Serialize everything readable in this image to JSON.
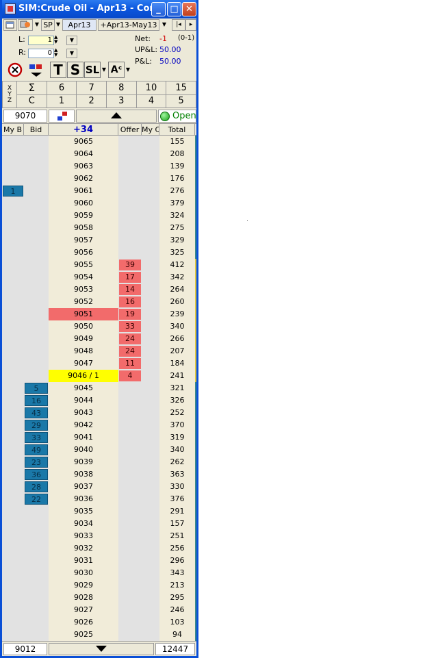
{
  "window": {
    "title": "SIM:Crude Oil - Apr13 - Con...",
    "minimize_label": "_",
    "maximize_label": "□",
    "close_label": "✕"
  },
  "toolbar": {
    "exchange": "SP",
    "contract": "Apr13",
    "spread": "+Apr13-May13",
    "nav_first": "|◂",
    "nav_next": "▸"
  },
  "order_entry": {
    "l_label": "L:",
    "l_value": "1",
    "r_label": "R:",
    "r_value": "0"
  },
  "position": {
    "net_label": "Net:",
    "net_value": "-1",
    "net_detail": "(0-1)",
    "upl_label": "UP&L:",
    "upl_value": "50.00",
    "pl_label": "P&L:",
    "pl_value": "50.00"
  },
  "tool_buttons": {
    "t_label": "T",
    "s_label": "S",
    "sl_label": "SL",
    "alpha_label": "Aᶜ"
  },
  "quantity_grid": {
    "row1_label": "X",
    "row2_label": "Y",
    "row3_label": "Z",
    "row1": [
      "Σ",
      "6",
      "7",
      "8",
      "10",
      "15"
    ],
    "row2": [
      "C",
      "1",
      "2",
      "3",
      "4",
      "5"
    ]
  },
  "status": {
    "price": "9070",
    "market_state": "Open"
  },
  "columns": {
    "my_bid": "My B",
    "bid": "Bid",
    "net_change": "+34",
    "offer": "Offer",
    "my_offer": "My C",
    "total": "Total"
  },
  "ladder": [
    {
      "price": "9065",
      "total": "155",
      "my_bid": "",
      "bid": "",
      "offer": ""
    },
    {
      "price": "9064",
      "total": "208",
      "my_bid": "",
      "bid": "",
      "offer": ""
    },
    {
      "price": "9063",
      "total": "139",
      "my_bid": "",
      "bid": "",
      "offer": ""
    },
    {
      "price": "9062",
      "total": "176",
      "my_bid": "",
      "bid": "",
      "offer": ""
    },
    {
      "price": "9061",
      "total": "276",
      "my_bid": "1",
      "bid": "",
      "offer": ""
    },
    {
      "price": "9060",
      "total": "379",
      "my_bid": "",
      "bid": "",
      "offer": ""
    },
    {
      "price": "9059",
      "total": "324",
      "my_bid": "",
      "bid": "",
      "offer": ""
    },
    {
      "price": "9058",
      "total": "275",
      "my_bid": "",
      "bid": "",
      "offer": ""
    },
    {
      "price": "9057",
      "total": "329",
      "my_bid": "",
      "bid": "",
      "offer": ""
    },
    {
      "price": "9056",
      "total": "325",
      "my_bid": "",
      "bid": "",
      "offer": ""
    },
    {
      "price": "9055",
      "total": "412",
      "my_bid": "",
      "bid": "",
      "offer": "39"
    },
    {
      "price": "9054",
      "total": "342",
      "my_bid": "",
      "bid": "",
      "offer": "17"
    },
    {
      "price": "9053",
      "total": "264",
      "my_bid": "",
      "bid": "",
      "offer": "14"
    },
    {
      "price": "9052",
      "total": "260",
      "my_bid": "",
      "bid": "",
      "offer": "16"
    },
    {
      "price": "9051",
      "total": "239",
      "my_bid": "",
      "bid": "",
      "offer": "19",
      "last": true
    },
    {
      "price": "9050",
      "total": "340",
      "my_bid": "",
      "bid": "",
      "offer": "33"
    },
    {
      "price": "9049",
      "total": "266",
      "my_bid": "",
      "bid": "",
      "offer": "24"
    },
    {
      "price": "9048",
      "total": "207",
      "my_bid": "",
      "bid": "",
      "offer": "24"
    },
    {
      "price": "9047",
      "total": "184",
      "my_bid": "",
      "bid": "",
      "offer": "11"
    },
    {
      "price": "9046 / 1",
      "total": "241",
      "my_bid": "",
      "bid": "",
      "offer": "4",
      "inside": true
    },
    {
      "price": "9045",
      "total": "321",
      "my_bid": "",
      "bid": "5",
      "offer": ""
    },
    {
      "price": "9044",
      "total": "326",
      "my_bid": "",
      "bid": "16",
      "offer": ""
    },
    {
      "price": "9043",
      "total": "252",
      "my_bid": "",
      "bid": "43",
      "offer": ""
    },
    {
      "price": "9042",
      "total": "370",
      "my_bid": "",
      "bid": "29",
      "offer": ""
    },
    {
      "price": "9041",
      "total": "319",
      "my_bid": "",
      "bid": "33",
      "offer": ""
    },
    {
      "price": "9040",
      "total": "340",
      "my_bid": "",
      "bid": "49",
      "offer": ""
    },
    {
      "price": "9039",
      "total": "262",
      "my_bid": "",
      "bid": "23",
      "offer": ""
    },
    {
      "price": "9038",
      "total": "363",
      "my_bid": "",
      "bid": "36",
      "offer": ""
    },
    {
      "price": "9037",
      "total": "330",
      "my_bid": "",
      "bid": "28",
      "offer": ""
    },
    {
      "price": "9036",
      "total": "376",
      "my_bid": "",
      "bid": "22",
      "offer": ""
    },
    {
      "price": "9035",
      "total": "291",
      "my_bid": "",
      "bid": "",
      "offer": ""
    },
    {
      "price": "9034",
      "total": "157",
      "my_bid": "",
      "bid": "",
      "offer": ""
    },
    {
      "price": "9033",
      "total": "251",
      "my_bid": "",
      "bid": "",
      "offer": ""
    },
    {
      "price": "9032",
      "total": "256",
      "my_bid": "",
      "bid": "",
      "offer": ""
    },
    {
      "price": "9031",
      "total": "296",
      "my_bid": "",
      "bid": "",
      "offer": ""
    },
    {
      "price": "9030",
      "total": "343",
      "my_bid": "",
      "bid": "",
      "offer": ""
    },
    {
      "price": "9029",
      "total": "213",
      "my_bid": "",
      "bid": "",
      "offer": ""
    },
    {
      "price": "9028",
      "total": "295",
      "my_bid": "",
      "bid": "",
      "offer": ""
    },
    {
      "price": "9027",
      "total": "246",
      "my_bid": "",
      "bid": "",
      "offer": ""
    },
    {
      "price": "9026",
      "total": "103",
      "my_bid": "",
      "bid": "",
      "offer": ""
    },
    {
      "price": "9025",
      "total": "94",
      "my_bid": "",
      "bid": "",
      "offer": ""
    }
  ],
  "footer": {
    "low_price": "9012",
    "total_volume": "12447"
  },
  "colors": {
    "bid": "#1a78a8",
    "offer": "#f26b6b",
    "inside": "#ffff00",
    "price_column": "#f1ecd9",
    "upl_value": "#0000c0",
    "net_value": "#d00000",
    "open_status": "#008000"
  }
}
